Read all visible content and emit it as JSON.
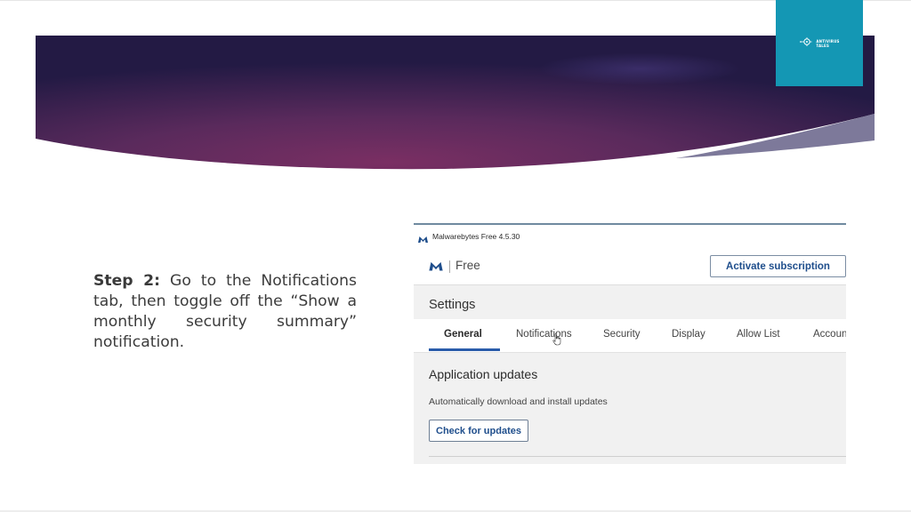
{
  "slide": {
    "step_label": "Step 2:",
    "step_body": "Go to the Notifications tab, then toggle off the “Show a monthly security summary” notification."
  },
  "logo": {
    "line1": "ANTIVIRUS",
    "line2": "TALES",
    "icon": "virus-icon"
  },
  "colors": {
    "banner_dark": "#2b1a4a",
    "banner_mid": "#6a2b62",
    "logo_box": "#1497b4",
    "accent_blue": "#2a5caa"
  },
  "app": {
    "window_title": "Malwarebytes Free  4.5.30",
    "app_name": "Free",
    "activate_label": "Activate subscription",
    "settings_title": "Settings",
    "tabs": [
      {
        "label": "General",
        "active": true
      },
      {
        "label": "Notifications",
        "active": false
      },
      {
        "label": "Security",
        "active": false
      },
      {
        "label": "Display",
        "active": false
      },
      {
        "label": "Allow List",
        "active": false
      },
      {
        "label": "Accoun",
        "active": false
      }
    ],
    "section_title": "Application updates",
    "section_desc": "Automatically download and install updates",
    "check_label": "Check for updates"
  }
}
